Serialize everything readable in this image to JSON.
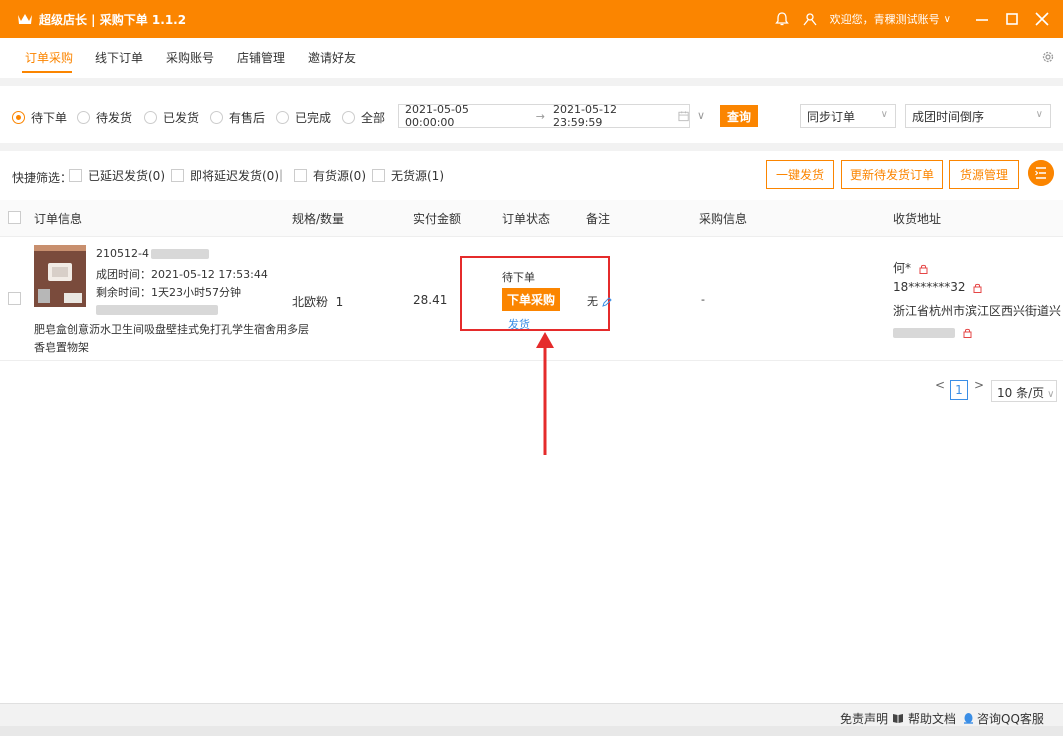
{
  "app": {
    "title": "超级店长 | 采购下单 1.1.2",
    "welcome": "欢迎您，青稞测试账号",
    "brand_color": "#fb8500",
    "icons": [
      "crown-icon",
      "bell-icon",
      "user-icon",
      "minimize-icon",
      "maximize-icon",
      "close-icon"
    ]
  },
  "nav": {
    "tabs": [
      "订单采购",
      "线下订单",
      "采购账号",
      "店铺管理",
      "邀请好友"
    ],
    "active_tab": "订单采购"
  },
  "filters": {
    "statuses": [
      "待下单",
      "待发货",
      "已发货",
      "有售后",
      "已完成",
      "全部"
    ],
    "selected_status": "待下单",
    "date_start": "2021-05-05 00:00:00",
    "date_arrow": "→",
    "date_end": "2021-05-12 23:59:59",
    "query_label": "查询",
    "sync_select": "同步订单",
    "sort_select": "成团时间倒序"
  },
  "quick": {
    "label": "快捷筛选：",
    "options": [
      "已延迟发货(0)",
      "即将延迟发货(0)",
      "有货源(0)",
      "无货源(1)"
    ],
    "separator": "|",
    "buttons": [
      "一键发货",
      "更新待发货订单",
      "货源管理"
    ]
  },
  "table": {
    "headers": [
      "订单信息",
      "规格/数量",
      "实付金额",
      "订单状态",
      "备注",
      "采购信息",
      "收货地址"
    ],
    "rows": [
      {
        "order_id": "210512-4",
        "group_time": "成团时间：2021-05-12 17:53:44",
        "remaining": "剩余时间：1天23小时57分钟",
        "product_name_l1": "肥皂盒创意沥水卫生间吸盘壁挂式免打孔学生宿舍用多层",
        "product_name_l2": "香皂置物架",
        "spec": "北欧粉",
        "qty": "1",
        "amount": "28.41",
        "status": "待下单",
        "order_button": "下单采购",
        "ship_link": "发货",
        "note": "无",
        "purchase_info": "-",
        "recipient": "何*",
        "phone": "18*******32",
        "address": "浙江省杭州市滨江区西兴街道兴"
      }
    ]
  },
  "pagination": {
    "prev": "<",
    "current": "1",
    "next": ">",
    "page_size": "10 条/页"
  },
  "footer": {
    "disclaimer": "免责声明",
    "help": "帮助文档",
    "qq": "咨询QQ客服",
    "qq_color": "#3a8ee6"
  },
  "annotation": {
    "highlight_color": "#e52b2b"
  }
}
